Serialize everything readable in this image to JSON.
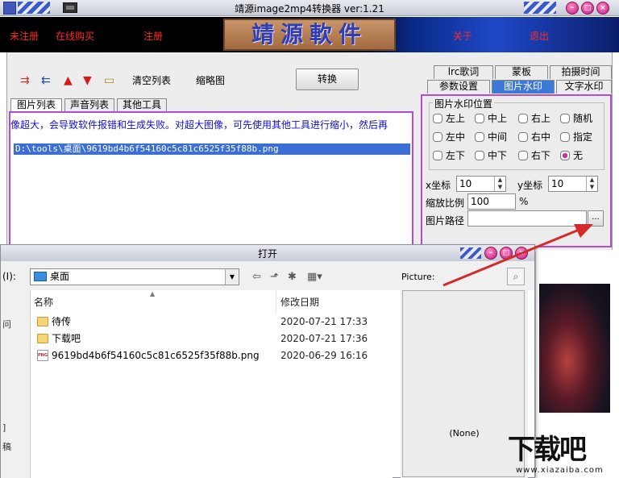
{
  "app": {
    "title": "靖源image2mp4转换器 ver:1.21",
    "logo_text": "靖源軟件"
  },
  "banner_links": {
    "unregistered": "未注册",
    "buy_online": "在线购买",
    "register": "注册",
    "about": "关于",
    "exit": "退出"
  },
  "toolbar": {
    "clear_list": "清空列表",
    "thumbnail": "缩略图",
    "convert": "转换"
  },
  "left_tabs": [
    "图片列表",
    "声音列表",
    "其他工具"
  ],
  "list": {
    "warning": "像超大，会导致软件报错和生成失败。对超大图像，可先使用其他工具进行缩小，然后再",
    "file_path": "D:\\tools\\桌面\\9619bd4b6f54160c5c81c6525f35f88b.png"
  },
  "right_tabs": {
    "row1": [
      "lrc歌词",
      "蒙板",
      "拍摄时间"
    ],
    "row2": [
      "参数设置",
      "图片水印",
      "文字水印"
    ],
    "active": "图片水印"
  },
  "watermark": {
    "group_title": "图片水印位置",
    "positions": [
      "左上",
      "中上",
      "右上",
      "随机",
      "左中",
      "中间",
      "右中",
      "指定",
      "左下",
      "中下",
      "右下",
      "无"
    ],
    "selected": "无",
    "x_label": "x坐标",
    "x_value": "10",
    "y_label": "y坐标",
    "y_value": "10",
    "scale_label": "缩放比例",
    "scale_value": "100",
    "scale_unit": "%",
    "path_label": "图片路径",
    "path_value": "",
    "browse": "..."
  },
  "dialog": {
    "title": "打开",
    "look_in_label": "(I):",
    "look_in_value": "桌面",
    "picture_label": "Picture:",
    "preview_none": "(None)",
    "columns": {
      "name": "名称",
      "date": "修改日期"
    },
    "files": [
      {
        "name": "待传",
        "date": "2020-07-21 17:33",
        "type": "folder"
      },
      {
        "name": "下载吧",
        "date": "2020-07-21 17:36",
        "type": "folder"
      },
      {
        "name": "9619bd4b6f54160c5c81c6525f35f88b.png",
        "date": "2020-06-29 16:16",
        "type": "png"
      }
    ],
    "places_chars": [
      "问",
      "]",
      "稿"
    ]
  },
  "watermark_logo": {
    "text": "下载吧",
    "url": "www.xiazaiba.com"
  },
  "colors": {
    "banner_link": "#ff2a2a",
    "selection": "#3b6fd6",
    "panel_border": "#b44bd8",
    "active_tab": "#3d7ad8",
    "warning_text": "#1010c8",
    "annotation_arrow": "#d42a2a"
  },
  "icons": [
    "add-icon",
    "remove-icon",
    "up-arrow-icon",
    "down-arrow-icon",
    "folder-icon",
    "back-icon",
    "up-folder-icon",
    "new-folder-icon",
    "view-menu-icon",
    "preview-icon"
  ]
}
